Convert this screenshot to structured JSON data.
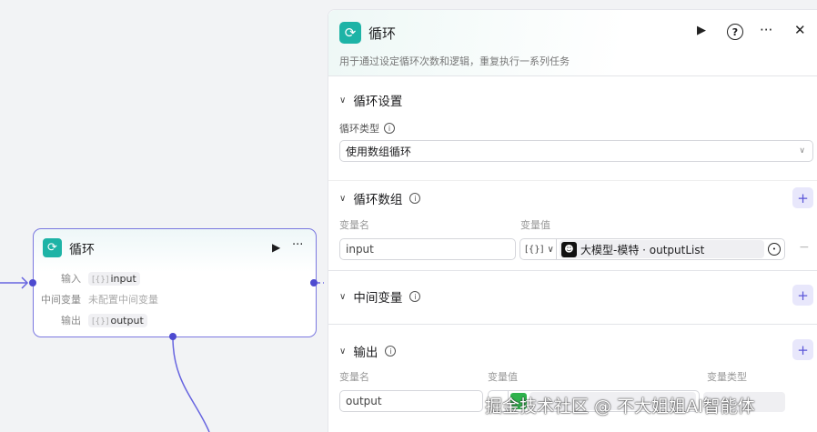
{
  "node": {
    "title": "循环",
    "rows": [
      {
        "label": "输入",
        "value": "input",
        "type": "[{}]"
      },
      {
        "label": "中间变量",
        "value": "未配置中间变量"
      },
      {
        "label": "输出",
        "value": "output",
        "type": "[{}]"
      }
    ]
  },
  "panel": {
    "title": "循环",
    "description": "用于通过设定循环次数和逻辑，重复执行一系列任务",
    "settings": {
      "title": "循环设置",
      "type_label": "循环类型",
      "type_value": "使用数组循环"
    },
    "loop_array": {
      "title": "循环数组",
      "col_name": "变量名",
      "col_value": "变量值",
      "name": "input",
      "type_tag": "[{}]",
      "ref": "大模型-模特 · outputList"
    },
    "intermediate": {
      "title": "中间变量"
    },
    "output": {
      "title": "输出",
      "col_name": "变量名",
      "col_value": "变量值",
      "col_type": "变量类型",
      "name": "output"
    }
  },
  "watermark": "掘金技术社区 @ 不大姐姐AI智能体",
  "colors": {
    "accent": "#1db3a6",
    "edge": "#4d4ad0"
  }
}
